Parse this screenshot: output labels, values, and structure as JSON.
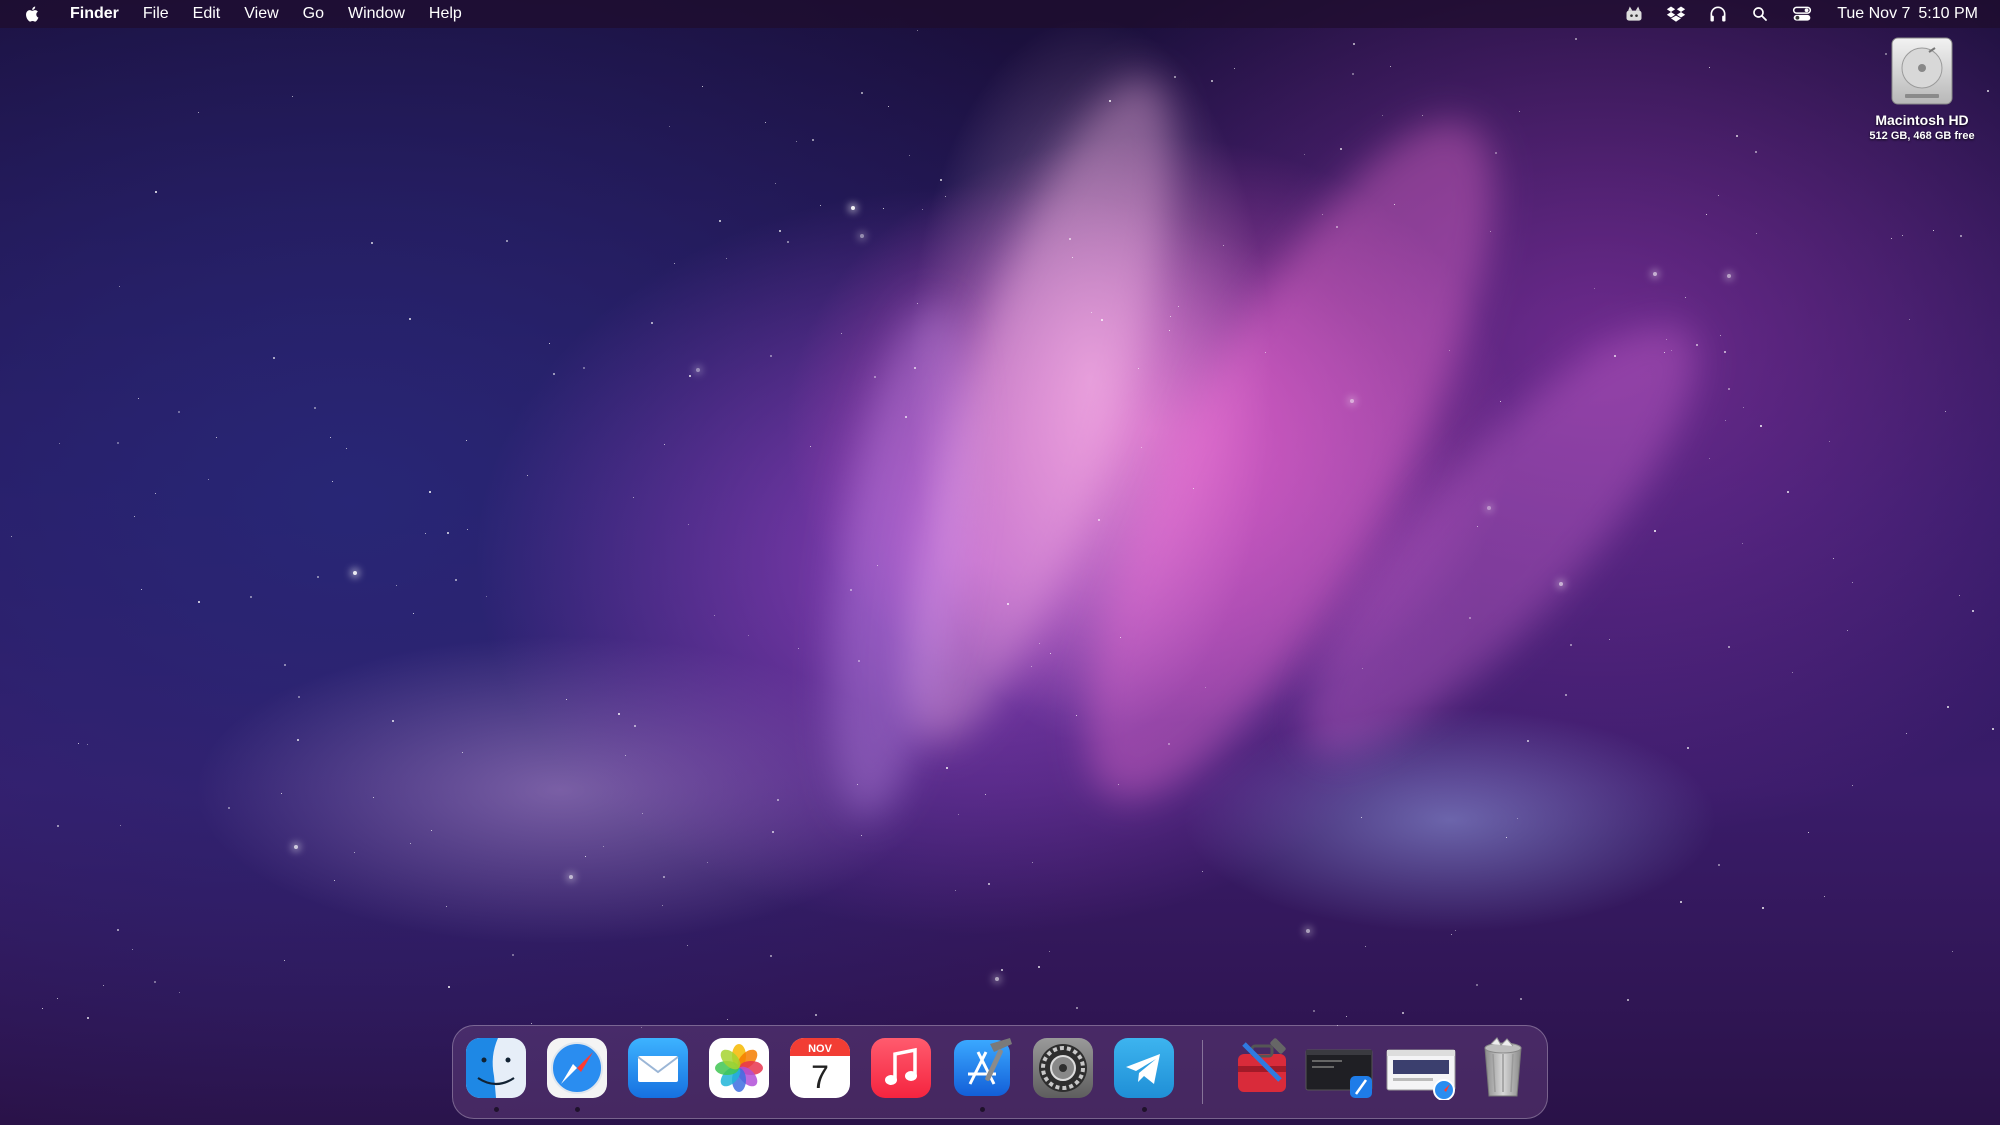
{
  "menubar": {
    "apple_icon": "apple-logo-icon",
    "app_name": "Finder",
    "menus": [
      "File",
      "Edit",
      "View",
      "Go",
      "Window",
      "Help"
    ],
    "status_icons": [
      "robot-cat-icon",
      "dropbox-icon",
      "headphones-icon",
      "spotlight-search-icon",
      "control-center-icon"
    ],
    "clock": {
      "date": "Tue Nov 7",
      "time": "5:10 PM"
    }
  },
  "desktop": {
    "icons": [
      {
        "name": "Macintosh HD",
        "info": "512 GB, 468 GB free",
        "icon": "hard-drive-icon"
      }
    ]
  },
  "dock": {
    "apps": [
      {
        "name": "Finder",
        "icon": "finder-icon",
        "running": true
      },
      {
        "name": "Safari",
        "icon": "safari-icon",
        "running": true
      },
      {
        "name": "Mail",
        "icon": "mail-icon",
        "running": false
      },
      {
        "name": "Photos",
        "icon": "photos-icon",
        "running": false
      },
      {
        "name": "Calendar",
        "icon": "calendar-icon",
        "running": false,
        "month": "NOV",
        "day": "7"
      },
      {
        "name": "Music",
        "icon": "music-icon",
        "running": false
      },
      {
        "name": "Xcode",
        "icon": "xcode-icon",
        "running": true
      },
      {
        "name": "System Settings",
        "icon": "system-settings-icon",
        "running": false
      },
      {
        "name": "Telegram",
        "icon": "telegram-icon",
        "running": true
      }
    ],
    "others": [
      {
        "name": "Developer Toolbox",
        "icon": "toolbox-icon"
      },
      {
        "name": "Xcode window",
        "icon": "minimized-window-xcode-icon"
      },
      {
        "name": "Safari window",
        "icon": "minimized-window-safari-icon"
      },
      {
        "name": "Trash",
        "icon": "trash-full-icon"
      }
    ]
  },
  "colors": {
    "menubar_bg": "#1e0c2d",
    "accent_blue": "#1e88e5",
    "wallpaper_pink": "#e65ac8",
    "wallpaper_purple": "#3a1c6a"
  }
}
